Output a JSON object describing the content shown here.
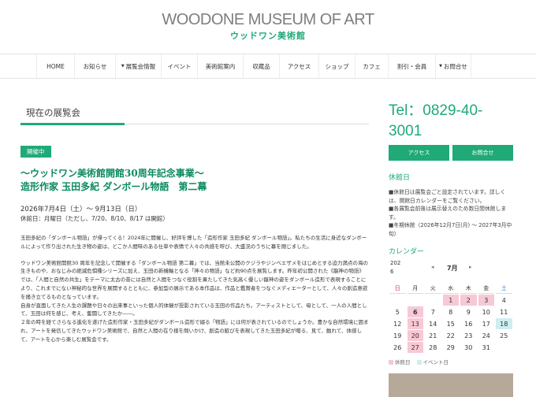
{
  "logo": {
    "en": "WOODONE MUSEUM OF ART",
    "jp": "ウッドワン美術館"
  },
  "nav": [
    {
      "label": "HOME",
      "caret": false
    },
    {
      "label": "お知らせ",
      "caret": false
    },
    {
      "label": "展覧会情報",
      "caret": true
    },
    {
      "label": "イベント",
      "caret": false
    },
    {
      "label": "美術館案内",
      "caret": false
    },
    {
      "label": "収蔵品",
      "caret": false
    },
    {
      "label": "アクセス",
      "caret": false
    },
    {
      "label": "ショップ",
      "caret": false
    },
    {
      "label": "カフェ",
      "caret": false
    },
    {
      "label": "割引・会員",
      "caret": false
    },
    {
      "label": "お問合せ",
      "caret": true
    }
  ],
  "main": {
    "section_title": "現在の展覧会",
    "badge": "開催中",
    "title_line1": "〜ウッドワン美術館開館30周年記念事業〜",
    "title_line2": "造形作家 玉田多紀 ダンボール物語　第二幕",
    "dates": "2026年7月4日（土）〜 9月13日（日）",
    "closed": "休館日：月曜日（ただし、7/20、8/10、8/17 は開館）",
    "para1": "玉田多紀の「ダンボール物語」が帰ってくる！2024年に開催し、好評を博した「造形作家 玉田多紀 ダンボール物語」。私たちの生活に身近なダンボールによって作り出された生き物の姿は、どこか人間味のある仕草や表情で人々の共感を呼び、大盛況のうちに幕を閉じました。",
    "para2": "ウッドワン美術館開館30 周年を記念して開催する「ダンボール物語 第二幕」では、当館未公開のクジラやジンベエザメをはじめとする迫力満点の海の生きものや、おなじみの絶滅危惧種シリーズに加え、玉田の新機軸となる「神々の物語」など約90点を展覧します。昨年初公開された《龍神の物語》では、「人間と自然の共生」をテーマに太古の昔には自然と人間をつなぐ役割を果たしてきた気高く優しい龍神の姿をダンボール造形で表現することにより、これまでにない神秘的な世界を展開するとともに、参加型の展示である本作品は、作品と鑑賞者をつなぐメディエーターとして、人々の創造意欲を掻き立てるものとなっています。",
    "para3": "自身が直面してきた人生の課題や日々の出来事といった個人的体験が投影されている玉田の作品たち。アーティストとして、母として、一人の人間として、玉田は何を感じ、考え、奮闘してきたか――。",
    "para4": "２年の時を経てさらなる進化を遂げた造形作家・玉田多紀がダンボール造形で綴る「物語」には何が表されているのでしょうか。豊かな自然環境に囲まれ、アートを発信してきたウッドワン美術館で、自然と人間の在り様を問いかけ、創造の歓びを表現してきた玉田多紀が贈る、見て、触れて、体感して、アートを心から楽しむ展覧会です。"
  },
  "side": {
    "tel": "Tel：0829-40-3001",
    "access_label": "アクセス",
    "contact_label": "お問合せ",
    "closed_heading": "休館日",
    "info1": "■休館日は展覧会ごと設定されています。詳しくは、開館日カレンダーをご覧ください。",
    "info2": "■各展覧会前後は展示替えのため数日間休館します。",
    "info3": "■冬期休館（2026年12月7日(月) 〜 2027年3月中旬）",
    "calendar_heading": "カレンダー",
    "cal_year": "2026",
    "cal_prev": "◂",
    "cal_month": "7月",
    "cal_next": "▸",
    "weekdays": [
      "日",
      "月",
      "火",
      "水",
      "木",
      "金",
      "土"
    ],
    "legend_closed": "休館日",
    "legend_event": "イベント日",
    "colors": {
      "accent": "#1faa77",
      "closed": "#f7c8d5",
      "event": "#cdeef0"
    }
  },
  "calendar": [
    [
      "",
      "",
      "",
      "1",
      "2",
      "3",
      "4"
    ],
    [
      "5",
      "6",
      "7",
      "8",
      "9",
      "10",
      "11"
    ],
    [
      "12",
      "13",
      "14",
      "15",
      "16",
      "17",
      "18"
    ],
    [
      "19",
      "20",
      "21",
      "22",
      "23",
      "24",
      "25"
    ],
    [
      "26",
      "27",
      "28",
      "29",
      "30",
      "31",
      ""
    ]
  ],
  "calendar_marks": {
    "closed": [
      "1",
      "2",
      "3",
      "6",
      "13",
      "20",
      "27"
    ],
    "event": [
      "18"
    ],
    "today": "6"
  }
}
